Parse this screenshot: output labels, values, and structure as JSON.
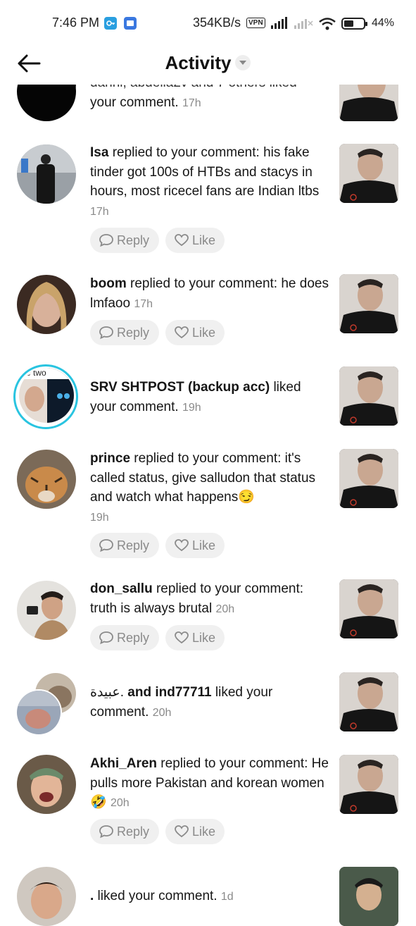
{
  "status_bar": {
    "time": "7:46 PM",
    "speed": "354KB/s",
    "vpn": "VPN",
    "battery": "44%"
  },
  "header": {
    "title": "Activity"
  },
  "items": [
    {
      "cut_text": "danni, abdella2v and 7 others liked",
      "text": "your comment.",
      "time": "17h"
    },
    {
      "user": "Isa",
      "text": " replied to your comment: his fake tinder got 100s of HTBs and stacys in hours, most ricecel fans are Indian ltbs",
      "time": "17h",
      "reply": "Reply",
      "like": "Like"
    },
    {
      "user": "boom",
      "text": " replied to your comment: he does lmfaoo",
      "time": "17h",
      "reply": "Reply",
      "like": "Like"
    },
    {
      "user": "SRV SHTPOST (backup acc)",
      "text": " liked your comment.",
      "time": "19h",
      "avatar_text": "ve two"
    },
    {
      "user": "prince",
      "text": " replied to your comment: it's called status, give salludon that status and watch what happens😏",
      "time": "19h",
      "reply": "Reply",
      "like": "Like"
    },
    {
      "user": "don_sallu",
      "text": " replied to your comment: truth is always brutal",
      "time": "20h",
      "reply": "Reply",
      "like": "Like"
    },
    {
      "pre": "عبيدة.",
      "user": " and ind77711",
      "text": " liked your comment.",
      "time": "20h"
    },
    {
      "user": "Akhi_Aren",
      "text": " replied to your comment: He pulls more Pakistan and korean women 🤣",
      "time": "20h",
      "reply": "Reply",
      "like": "Like"
    },
    {
      "user": ".",
      "text": " liked your comment.",
      "time": "1d"
    }
  ],
  "colors": {
    "ring": "#29c4e0",
    "muted": "#8a8a8a",
    "chip": "#f0f0f0"
  }
}
